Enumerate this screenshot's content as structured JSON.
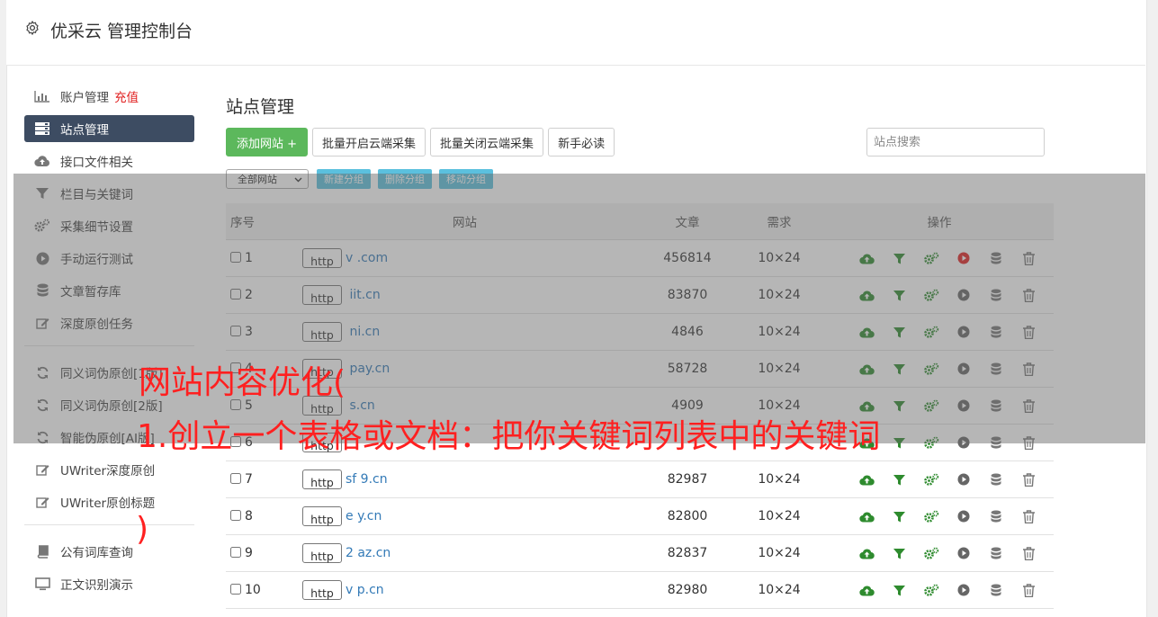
{
  "header": {
    "title": "优采云 管理控制台",
    "icon": "gear-icon"
  },
  "sidebar": {
    "items": [
      {
        "label": "账户管理",
        "extra": "充值",
        "icon": "bar-chart-icon"
      },
      {
        "label": "站点管理",
        "icon": "server-list-icon",
        "active": true
      },
      {
        "label": "接口文件相关",
        "icon": "cloud-upload-icon"
      },
      {
        "label": "栏目与关键词",
        "icon": "filter-icon"
      },
      {
        "label": "采集细节设置",
        "icon": "cogs-icon"
      },
      {
        "label": "手动运行测试",
        "icon": "play-circle-icon"
      },
      {
        "label": "文章暂存库",
        "icon": "database-icon"
      },
      {
        "label": "深度原创任务",
        "icon": "edit-icon"
      }
    ],
    "items2": [
      {
        "label": "同义词伪原创[1版]",
        "icon": "refresh-icon"
      },
      {
        "label": "同义词伪原创[2版]",
        "icon": "refresh-icon"
      },
      {
        "label": "智能伪原创[AI版]",
        "icon": "refresh-icon"
      },
      {
        "label": "UWriter深度原创",
        "icon": "edit-icon"
      },
      {
        "label": "UWriter原创标题",
        "icon": "edit-icon"
      }
    ],
    "items3": [
      {
        "label": "公有词库查询",
        "icon": "book-icon"
      },
      {
        "label": "正文识别演示",
        "icon": "monitor-icon"
      }
    ]
  },
  "main": {
    "title": "站点管理",
    "toolbar": {
      "add_site": "添加网站 +",
      "batch_open": "批量开启云端采集",
      "batch_close": "批量关闭云端采集",
      "guide": "新手必读"
    },
    "search_placeholder": "站点搜索",
    "group_select": "全部网站",
    "group_buttons": [
      "新建分组",
      "删除分组",
      "移动分组"
    ],
    "table": {
      "headers": [
        "序号",
        "网站",
        "文章",
        "需求",
        "操作"
      ],
      "http_label": "http",
      "rows": [
        {
          "no": "1",
          "site": "v          .com",
          "articles": "456814",
          "demand": "10×24",
          "run_active": true
        },
        {
          "no": "2",
          "site": "     iit.cn",
          "articles": "83870",
          "demand": "10×24"
        },
        {
          "no": "3",
          "site": "       ni.cn",
          "articles": "4846",
          "demand": "10×24"
        },
        {
          "no": "4",
          "site": "       pay.cn",
          "articles": "58728",
          "demand": "10×24"
        },
        {
          "no": "5",
          "site": "       s.cn",
          "articles": "4909",
          "demand": "10×24"
        },
        {
          "no": "6",
          "site": "",
          "articles": "",
          "demand": ""
        },
        {
          "no": "7",
          "site": "sf   9.cn",
          "articles": "82987",
          "demand": "10×24"
        },
        {
          "no": "8",
          "site": "e      y.cn",
          "articles": "82800",
          "demand": "10×24"
        },
        {
          "no": "9",
          "site": "2     az.cn",
          "articles": "82837",
          "demand": "10×24"
        },
        {
          "no": "10",
          "site": "v     p.cn",
          "articles": "82980",
          "demand": "10×24"
        }
      ]
    }
  },
  "overlay": {
    "line1": "网站内容优化(",
    "line2": "1.创立一个表格或文档：把你关键词列表中的关键词",
    "line3": ")"
  },
  "colors": {
    "active_nav": "#3d4c62",
    "green_button": "#5cb85c",
    "info_button": "#5bc0de",
    "link_blue": "#337ab7",
    "icon_green": "#2e8b2e",
    "run_red": "#e02020",
    "overlay_text": "#ff2020"
  }
}
